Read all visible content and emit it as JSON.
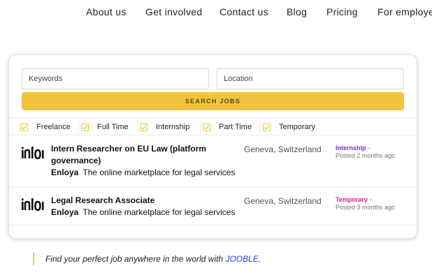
{
  "nav": {
    "items": [
      {
        "label": "About us"
      },
      {
        "label": "Get involved"
      },
      {
        "label": "Contact us"
      },
      {
        "label": "Blog"
      },
      {
        "label": "Pricing"
      },
      {
        "label": "For employer"
      }
    ]
  },
  "search": {
    "keywords_placeholder": "Keywords",
    "keywords_value": "",
    "location_placeholder": "Location",
    "location_value": "",
    "button_label": "SEARCH JOBS"
  },
  "filters": [
    {
      "label": "Freelance",
      "checked": true
    },
    {
      "label": "Full Time",
      "checked": true
    },
    {
      "label": "Internship",
      "checked": true
    },
    {
      "label": "Part Time",
      "checked": true
    },
    {
      "label": "Temporary",
      "checked": true
    }
  ],
  "jobs": [
    {
      "title": "Intern Researcher on EU Law (platform governance)",
      "company": "Enloya",
      "tagline": "The online marketplace for legal services",
      "location": "Geneva, Switzerland",
      "type": "Internship",
      "type_color": "#7b2fd0",
      "posted": "Posted 2 months ago",
      "logo_icon": "enloya-logo-icon"
    },
    {
      "title": "Legal Research Associate",
      "company": "Enloya",
      "tagline": "The online marketplace for legal services",
      "location": "Geneva, Switzerland",
      "type": "Temporary",
      "type_color": "#d6257a",
      "posted": "Posted 3 months ago",
      "logo_icon": "enloya-logo-icon"
    }
  ],
  "footer": {
    "text": "Find your perfect job anywhere in the world with ",
    "link_label": "JOOBLE",
    "suffix": "."
  },
  "colors": {
    "accent": "#f2c43e",
    "link": "#2b3fd6"
  }
}
